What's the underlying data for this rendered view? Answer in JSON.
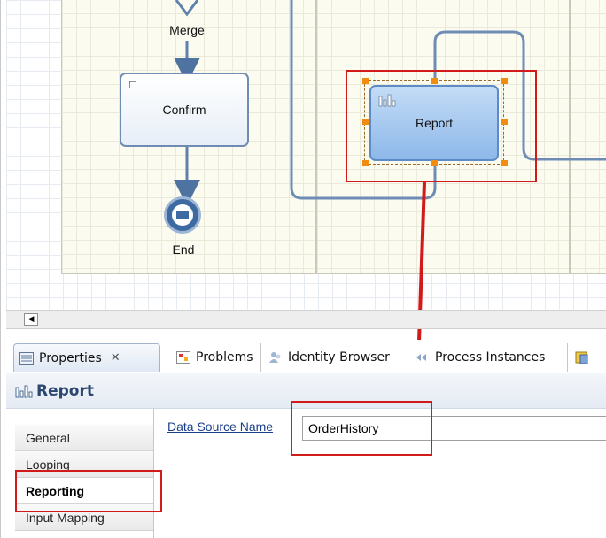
{
  "diagram": {
    "merge_label": "Merge",
    "confirm_task": "Confirm",
    "report_task": "Report",
    "end_event": "End"
  },
  "tabs": [
    {
      "label": "Properties",
      "icon": "properties-icon",
      "active": true
    },
    {
      "label": "Problems",
      "icon": "problems-icon"
    },
    {
      "label": "Identity Browser",
      "icon": "identity-icon"
    },
    {
      "label": "Process Instances",
      "icon": "process-instances-icon"
    }
  ],
  "properties": {
    "title": "Report",
    "nav": [
      "General",
      "Looping",
      "Reporting",
      "Input Mapping"
    ],
    "selected_nav": "Reporting",
    "data_source_label": "Data Source Name",
    "data_source_value": "OrderHistory"
  },
  "colors": {
    "highlight": "#d11a1a",
    "handle": "#f28c10",
    "task_border": "#6f8db4"
  }
}
